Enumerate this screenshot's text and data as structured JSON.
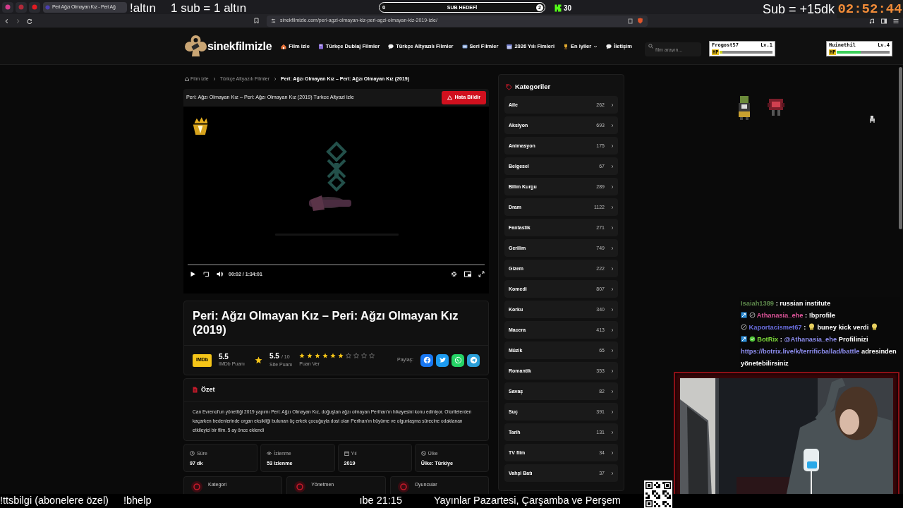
{
  "browser": {
    "tab_title": "Peri Ağzı Olmayan Kız - Peri Ağ",
    "url": "sinekfilmizle.com/peri-agzi-olmayan-kiz-peri-agzi-olmayan-kiz-2019-izle/"
  },
  "site": {
    "logo": "sinekfilmizle",
    "nav": [
      {
        "label": "Film izle",
        "kind": "link"
      },
      {
        "label": "Türkçe Dublaj Filmler",
        "kind": "link"
      },
      {
        "label": "Türkçe Altyazılı Filmler",
        "kind": "link"
      },
      {
        "label": "Seri Filmler",
        "kind": "link"
      },
      {
        "label": "2026 Yılı Fimleri",
        "kind": "link"
      },
      {
        "label": "En iyiler",
        "kind": "dropdown"
      },
      {
        "label": "İletişim",
        "kind": "link"
      }
    ],
    "search": {
      "placeholder": "film arayın..."
    }
  },
  "breadcrumb": [
    {
      "label": "Film izle",
      "selected": false
    },
    {
      "label": "Türkçe Altyazılı Filmler",
      "selected": false
    },
    {
      "label": "Peri: Ağzı Olmayan Kız – Peri: Ağzı Olmayan Kız (2019)",
      "selected": true
    }
  ],
  "player": {
    "heading": "Peri: Ağzı Olmayan Kız – Peri: Ağzı Olmayan Kız (2019) Turkce Altyazi izle",
    "report_button": "Hata Bildir",
    "time": "00:02 / 1:34:01",
    "level": 0
  },
  "movie": {
    "title": "Peri: Ağzı Olmayan Kız – Peri: Ağzı Olmayan Kız (2019)",
    "imdb": {
      "badge": "IMDb",
      "score": "5.5",
      "label": "IMDb Puanı"
    },
    "site_score": {
      "score": "5.5",
      "scale": "/ 10",
      "label": "Site Puanı"
    },
    "rate": {
      "stars": 6,
      "label": "Puan Ver"
    },
    "share": {
      "label": "Paylaş:",
      "buttons": [
        {
          "color": "#1877f2"
        },
        {
          "color": "#1d9bf0"
        },
        {
          "color": "#25d366"
        },
        {
          "color": "#2a9fd8"
        }
      ]
    }
  },
  "summary": {
    "heading": "Özet",
    "text": "Can Evrenol'un yönettiği 2019 yapımı Peri: Ağzı Olmayan Kız, doğuştan ağzı olmayan Perihan'ın hikayesini konu ediniyor. Otoritelerden kaçarken bedenlerinde organ eksikliği bulunan üç erkek çocuğuyla dost olan Perihan'ın büyüme ve olgunlaşma sürecine odaklanan etkileyici bir film. 5 ay önce eklendi"
  },
  "facts": [
    {
      "label": "Süre",
      "value": "97 dk"
    },
    {
      "label": "İzlenme",
      "value": "53 izlenme"
    },
    {
      "label": "Yıl",
      "value": "2019"
    },
    {
      "label": "Ülke",
      "value": "Ülke: Türkiye"
    }
  ],
  "links": [
    {
      "label": "Kategori"
    },
    {
      "label": "Yönetmen"
    },
    {
      "label": "Oyuncular"
    }
  ],
  "categories": {
    "heading": "Kategoriler",
    "items": [
      {
        "name": "Aile",
        "count": "262"
      },
      {
        "name": "Aksiyon",
        "count": "693"
      },
      {
        "name": "Animasyon",
        "count": "175"
      },
      {
        "name": "Belgesel",
        "count": "67"
      },
      {
        "name": "Bilim Kurgu",
        "count": "289"
      },
      {
        "name": "Dram",
        "count": "1122"
      },
      {
        "name": "Fantastik",
        "count": "271"
      },
      {
        "name": "Gerilim",
        "count": "749"
      },
      {
        "name": "Gizem",
        "count": "222"
      },
      {
        "name": "Komedi",
        "count": "807"
      },
      {
        "name": "Korku",
        "count": "340"
      },
      {
        "name": "Macera",
        "count": "413"
      },
      {
        "name": "Müzik",
        "count": "65"
      },
      {
        "name": "Romantik",
        "count": "353"
      },
      {
        "name": "Savaş",
        "count": "82"
      },
      {
        "name": "Suç",
        "count": "391"
      },
      {
        "name": "Tarih",
        "count": "131"
      },
      {
        "name": "TV film",
        "count": "34"
      },
      {
        "name": "Vahşi Batı",
        "count": "37"
      }
    ]
  },
  "overlay": {
    "top_texts": [
      "!altın",
      "1 sub = 1 altın"
    ],
    "sub_goal": {
      "start": "0",
      "label": "SUB HEDEFİ",
      "target": "2",
      "level": 0
    },
    "kick_count": "30",
    "sub_bonus": "Sub = +15dk",
    "timer": "02:52:44",
    "players": [
      {
        "name": "Frogost57",
        "rank": "Lv.1",
        "hp_label": "HP",
        "level": 0.05
      },
      {
        "name": "Huinethil",
        "rank": "Lv.4",
        "hp_label": "HP",
        "level": 0.45
      }
    ],
    "chat": [
      {
        "user": "Isaiah1389",
        "color": "#5e8a4c",
        "segments": [
          {
            "kind": "text",
            "text": ": russian institute"
          }
        ]
      },
      {
        "user": "Athanasia_ehe",
        "color": "#e0559b",
        "badges": [
          {
            "kind": "mod"
          },
          {
            "kind": "og"
          }
        ],
        "segments": [
          {
            "kind": "text",
            "text": ": !bprofile"
          }
        ]
      },
      {
        "user": "Kaportacismet67",
        "color": "#6a6ee0",
        "badges": [
          {
            "kind": "og"
          }
        ],
        "segments": [
          {
            "kind": "text",
            "text": ":"
          },
          {
            "kind": "emote"
          },
          {
            "kind": "text",
            "text": "buney kick verdi"
          },
          {
            "kind": "emote"
          }
        ]
      },
      {
        "user": "BotRix",
        "color": "#7ddb3a",
        "badges": [
          {
            "kind": "mod"
          },
          {
            "kind": "verified"
          }
        ],
        "segments": [
          {
            "kind": "text",
            "text": ":"
          },
          {
            "kind": "mention",
            "text": "@Athanasia_ehe"
          },
          {
            "kind": "text",
            "text": "Profilinizi"
          },
          {
            "kind": "link",
            "text": "https://botrix.live/k/terrificballad/battle"
          },
          {
            "kind": "text",
            "text": "adresinden yönetebilirsiniz"
          }
        ]
      }
    ],
    "ticker": [
      "!ttsbilgi (abonelere özel)",
      "!bhelp",
      "ıbe 21:15",
      "Yayınlar Pazartesi, Çarşamba ve Perşem"
    ]
  }
}
